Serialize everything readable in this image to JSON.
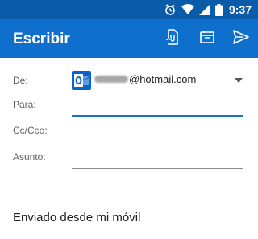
{
  "status_bar": {
    "time": "9:37",
    "icons": [
      "alarm-icon",
      "wifi-icon",
      "signal-icon",
      "battery-icon"
    ]
  },
  "app_bar": {
    "title": "Escribir",
    "actions": [
      "attach-file-icon",
      "attach-calendar-icon",
      "send-icon"
    ]
  },
  "compose": {
    "from_label": "De:",
    "from_account": "@hotmail.com",
    "to_label": "Para:",
    "cc_label": "Cc/Cco:",
    "subject_label": "Asunto:",
    "signature": "Enviado desde mi móvil"
  },
  "colors": {
    "status_bar": "#0a5ca8",
    "app_bar": "#0e6fcc",
    "accent": "#1a73c9"
  }
}
